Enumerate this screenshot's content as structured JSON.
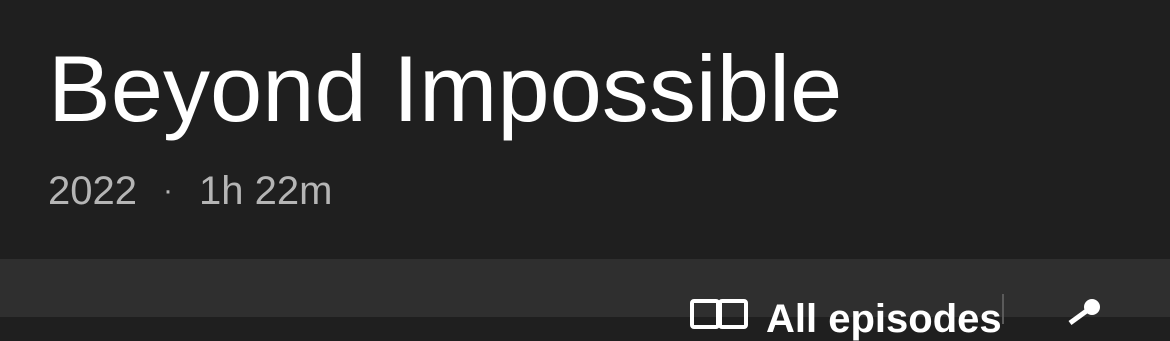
{
  "movie": {
    "title": "Beyond Impossible",
    "year": "2022",
    "separator": "·",
    "duration": "1h 22m"
  },
  "toolbar": {
    "all_episodes_label": "All episodes",
    "grid_icon": "grid-icon",
    "share_icon": "share-icon"
  },
  "colors": {
    "header_bg": "#1f1f1f",
    "toolbar_bg": "#2f2f2f",
    "title": "#ffffff",
    "meta": "#b5b5b5"
  }
}
